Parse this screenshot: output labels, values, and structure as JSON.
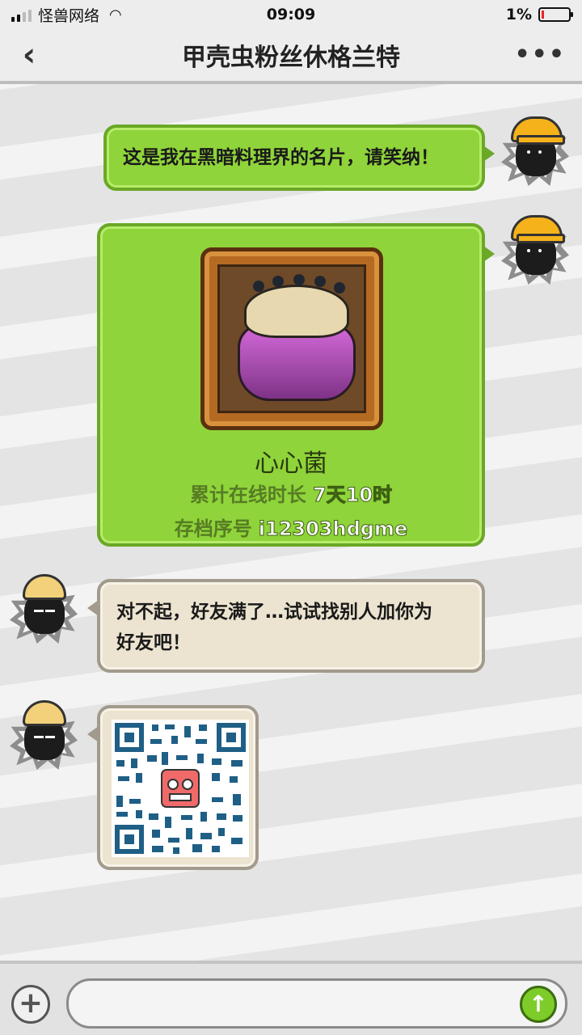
{
  "status_bar": {
    "carrier": "怪兽网络",
    "wifi_icon": "wifi-icon",
    "time": "09:09",
    "battery": "1%"
  },
  "header": {
    "back_icon": "‹",
    "title": "甲壳虫粉丝休格兰特",
    "more_icon": "•••"
  },
  "messages": [
    {
      "sender": "self",
      "type": "text",
      "text": "这是我在黑暗料理界的名片，请笑纳！"
    },
    {
      "sender": "self",
      "type": "card",
      "card": {
        "name": "心心菌",
        "online_label": "累计在线时长",
        "online_value": "7天10时",
        "save_label": "存档序号",
        "save_value": "i12303hdgme"
      }
    },
    {
      "sender": "friend",
      "type": "text",
      "text_line1": "对不起，好友满了…试试找别人加你为",
      "text_line2": "好友吧！"
    },
    {
      "sender": "friend",
      "type": "qr_code",
      "icon": "qr-code-icon"
    }
  ],
  "input_bar": {
    "plus_icon": "+",
    "placeholder": "",
    "send_icon": "↑"
  },
  "colors": {
    "self_bubble": "#8fd43a",
    "friend_bubble": "#ece4d0",
    "helmet": "#f5b21b"
  }
}
